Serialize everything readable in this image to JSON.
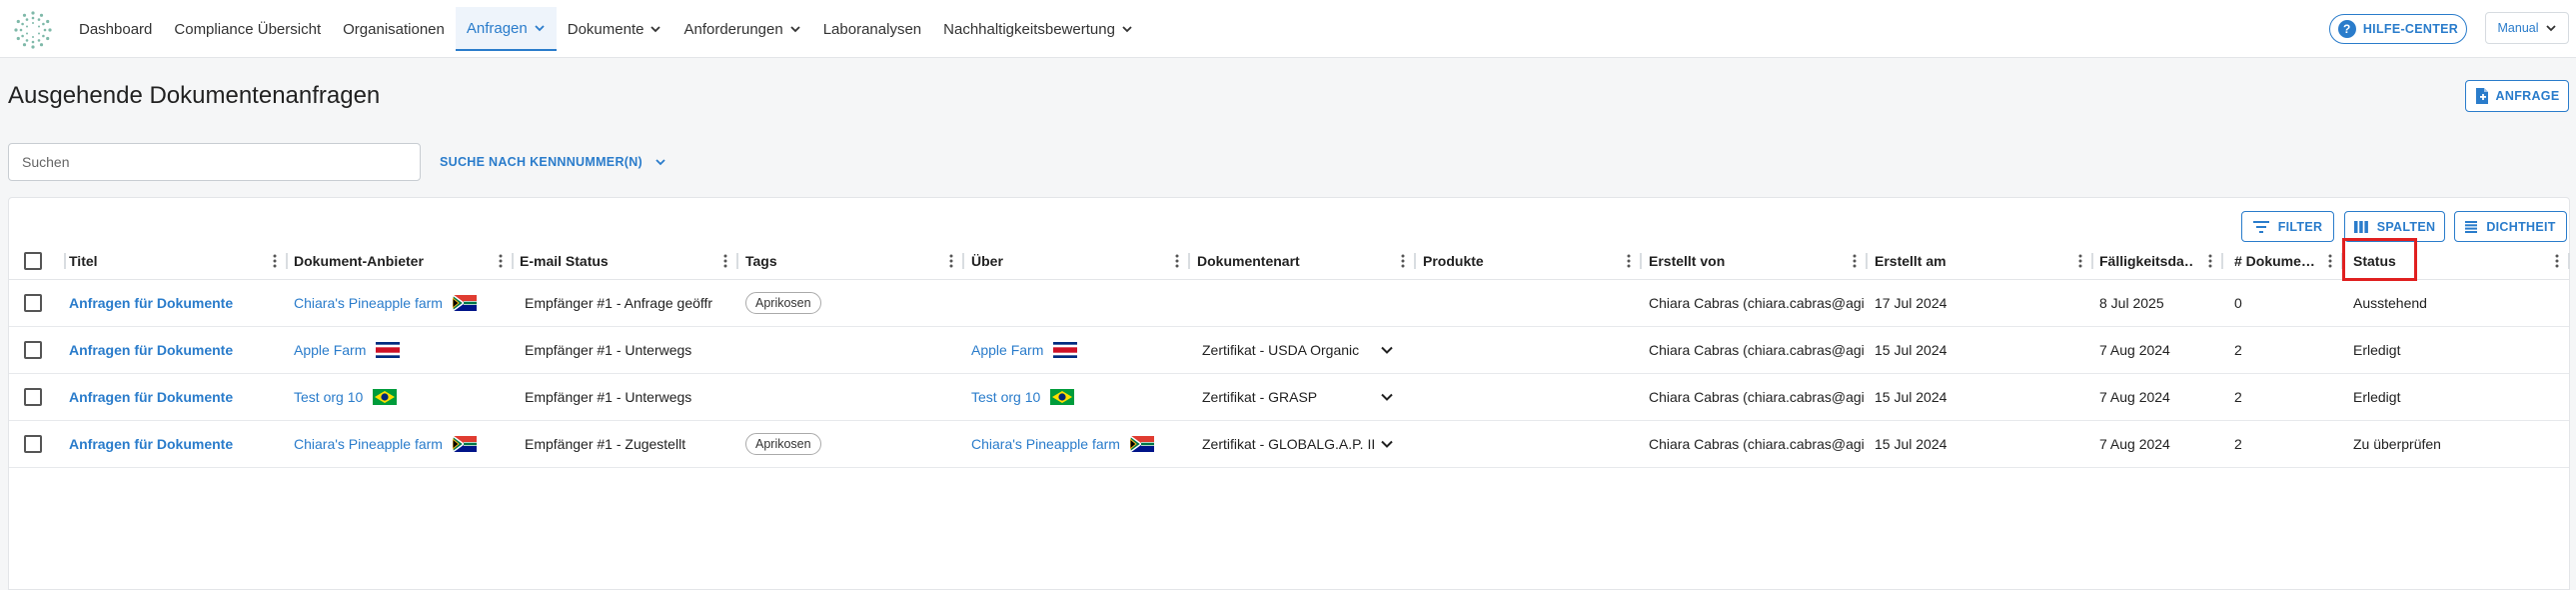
{
  "nav": {
    "items": [
      {
        "label": "Dashboard",
        "dropdown": false,
        "active": false
      },
      {
        "label": "Compliance Übersicht",
        "dropdown": false,
        "active": false
      },
      {
        "label": "Organisationen",
        "dropdown": false,
        "active": false
      },
      {
        "label": "Anfragen",
        "dropdown": true,
        "active": true
      },
      {
        "label": "Dokumente",
        "dropdown": true,
        "active": false
      },
      {
        "label": "Anforderungen",
        "dropdown": true,
        "active": false
      },
      {
        "label": "Laboranalysen",
        "dropdown": false,
        "active": false
      },
      {
        "label": "Nachhaltigkeitsbewertung",
        "dropdown": true,
        "active": false
      }
    ],
    "help_label": "HILFE-CENTER",
    "manual_label": "Manual"
  },
  "page": {
    "title": "Ausgehende Dokumentenanfragen",
    "new_request_label": "ANFRAGE",
    "search_placeholder": "Suchen",
    "id_search_label": "SUCHE NACH KENNNUMMER(N)"
  },
  "toolbar": {
    "filter_label": "FILTER",
    "columns_label": "SPALTEN",
    "density_label": "DICHTHEIT"
  },
  "columns": [
    "Titel",
    "Dokument-Anbieter",
    "E-mail Status",
    "Tags",
    "Über",
    "Dokumentenart",
    "Produkte",
    "Erstellt von",
    "Erstellt am",
    "Fälligkeitsda…",
    "# Dokume…",
    "Status"
  ],
  "rows": [
    {
      "title": "Anfragen für Dokumente",
      "provider": "Chiara's Pineapple farm",
      "provider_flag": "za",
      "email_status": "Empfänger #1 - Anfrage geöffr",
      "tag": "Aprikosen",
      "about": "",
      "about_flag": "",
      "doc_type": "",
      "products": "",
      "created_by": "Chiara Cabras (chiara.cabras@agi",
      "created_at": "17 Jul 2024",
      "due": "8 Jul 2025",
      "doc_count": "0",
      "status": "Ausstehend"
    },
    {
      "title": "Anfragen für Dokumente",
      "provider": "Apple Farm",
      "provider_flag": "cr",
      "email_status": "Empfänger #1 - Unterwegs",
      "tag": "",
      "about": "Apple Farm",
      "about_flag": "cr",
      "doc_type": "Zertifikat - USDA Organic",
      "products": "",
      "created_by": "Chiara Cabras (chiara.cabras@agi",
      "created_at": "15 Jul 2024",
      "due": "7 Aug 2024",
      "doc_count": "2",
      "status": "Erledigt"
    },
    {
      "title": "Anfragen für Dokumente",
      "provider": "Test org 10",
      "provider_flag": "br",
      "email_status": "Empfänger #1 - Unterwegs",
      "tag": "",
      "about": "Test org 10",
      "about_flag": "br",
      "doc_type": "Zertifikat - GRASP",
      "products": "",
      "created_by": "Chiara Cabras (chiara.cabras@agi",
      "created_at": "15 Jul 2024",
      "due": "7 Aug 2024",
      "doc_count": "2",
      "status": "Erledigt"
    },
    {
      "title": "Anfragen für Dokumente",
      "provider": "Chiara's Pineapple farm",
      "provider_flag": "za",
      "email_status": "Empfänger #1 - Zugestellt",
      "tag": "Aprikosen",
      "about": "Chiara's Pineapple farm",
      "about_flag": "za",
      "doc_type": "Zertifikat - GLOBALG.A.P. II",
      "products": "",
      "created_by": "Chiara Cabras (chiara.cabras@agi",
      "created_at": "15 Jul 2024",
      "due": "7 Aug 2024",
      "doc_count": "2",
      "status": "Zu überprüfen"
    }
  ],
  "colors": {
    "accent": "#2a7ccb",
    "highlight": "#e02020"
  }
}
